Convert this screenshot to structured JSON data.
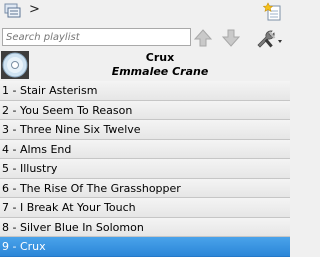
{
  "toolbar": {
    "playlists_icon": "playlists-stack-icon",
    "chevron": ">",
    "new_icon": "star-document-icon"
  },
  "search": {
    "placeholder": "Search playlist",
    "value": ""
  },
  "controls": {
    "move_up_icon": "arrow-up-icon",
    "move_down_icon": "arrow-down-icon",
    "tools_icon": "wrench-screwdriver-icon"
  },
  "now_playing": {
    "title": "Crux",
    "artist": "Emmalee Crane",
    "icon": "cd-disc-icon"
  },
  "tracks": [
    "1 - Stair Asterism",
    "2 - You Seem To Reason",
    "3 - Three Nine Six Twelve",
    "4 - Alms End",
    "5 - Illustry",
    "6 - The Rise Of The Grasshopper",
    "7 - I Break At Your Touch",
    "8 - Silver Blue In Solomon",
    "9 - Crux"
  ],
  "selected_index": 8,
  "colors": {
    "selection": "#3a95e2",
    "row": "#ececec"
  }
}
